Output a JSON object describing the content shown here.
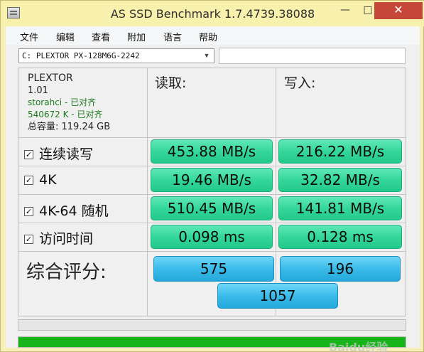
{
  "window": {
    "title": "AS SSD Benchmark 1.7.4739.38088",
    "minimize_glyph": "—",
    "maximize_glyph": "□",
    "close_glyph": "✕"
  },
  "menu": [
    "文件",
    "编辑",
    "查看",
    "附加",
    "语言",
    "帮助"
  ],
  "drive": {
    "selected": "C: PLEXTOR PX-128M6G-2242",
    "extra_input": ""
  },
  "info": {
    "model": "PLEXTOR",
    "firmware": "1.01",
    "driver": "storahci - 已对齐",
    "alignment": "540672 K - 已对齐",
    "capacity": "总容量: 119.24 GB"
  },
  "columns": {
    "read": "读取:",
    "write": "写入:"
  },
  "rows": [
    {
      "label": "连续读写",
      "checked": true,
      "read": "453.88 MB/s",
      "write": "216.22 MB/s"
    },
    {
      "label": "4K",
      "checked": true,
      "read": "19.46 MB/s",
      "write": "32.82 MB/s"
    },
    {
      "label": "4K-64 随机",
      "checked": true,
      "read": "510.45 MB/s",
      "write": "141.81 MB/s"
    },
    {
      "label": "访问时间",
      "checked": true,
      "read": "0.098 ms",
      "write": "0.128 ms"
    }
  ],
  "score": {
    "label": "综合评分:",
    "read": "575",
    "write": "196",
    "total": "1057"
  },
  "status": {
    "progress_fraction": 0.0,
    "status_fraction": 1.0
  },
  "watermark": "Baidu经验",
  "colors": {
    "value_green": "#34d79c",
    "score_blue": "#3bbbe9",
    "status_green": "#17b51a",
    "title_bar": "#f8f1ae"
  }
}
